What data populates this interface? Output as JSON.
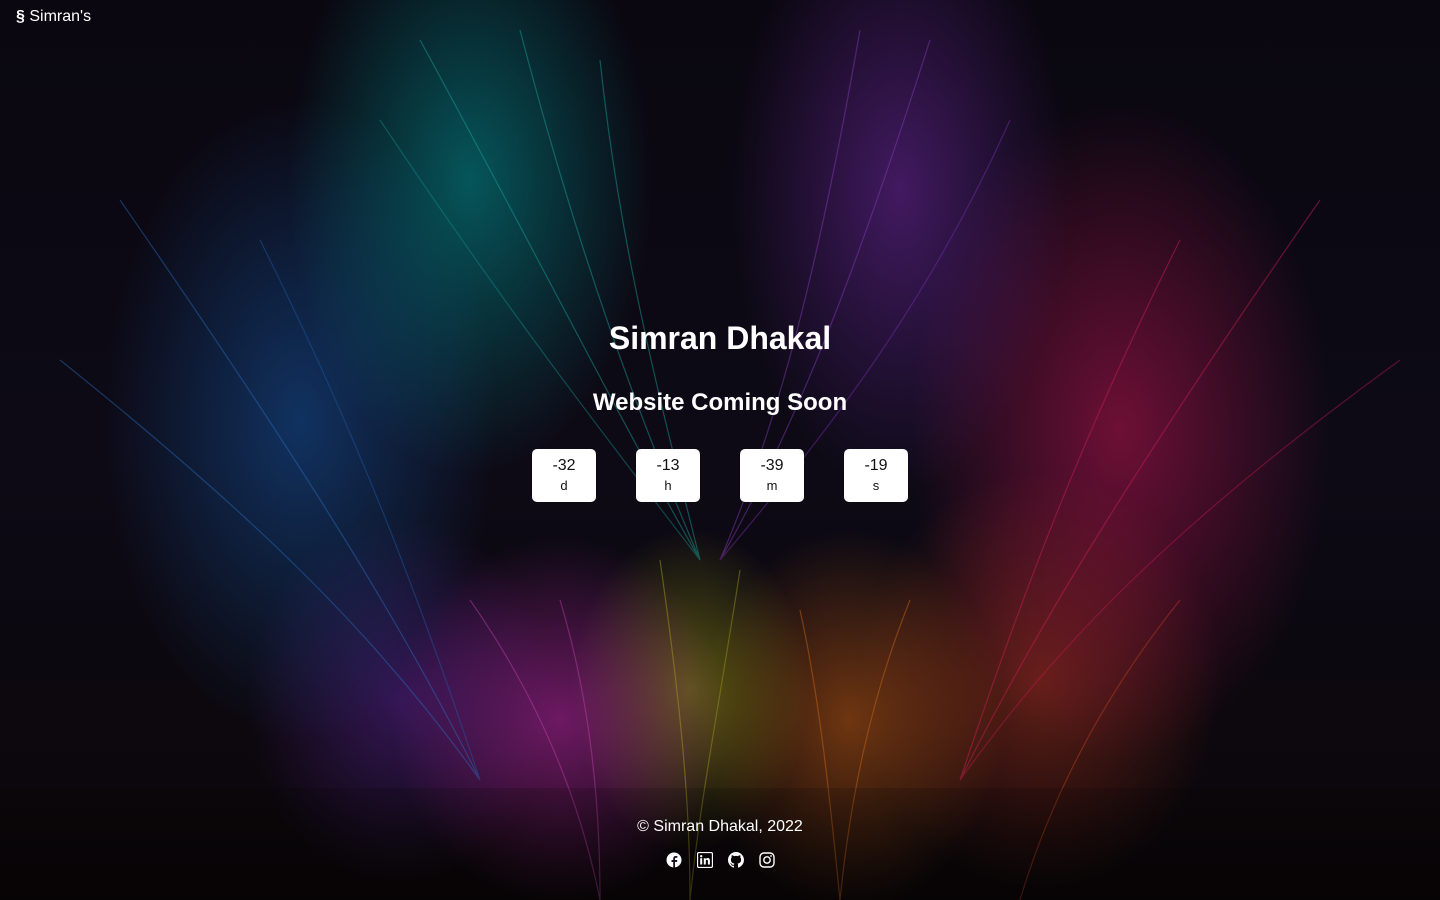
{
  "brand": {
    "symbol": "§",
    "name": "Simran's"
  },
  "hero": {
    "title": "Simran Dhakal",
    "subtitle": "Website Coming Soon"
  },
  "countdown": [
    {
      "value": "-32",
      "unit": "d"
    },
    {
      "value": "-13",
      "unit": "h"
    },
    {
      "value": "-39",
      "unit": "m"
    },
    {
      "value": "-19",
      "unit": "s"
    }
  ],
  "footer": {
    "copyright": "© Simran Dhakal, 2022",
    "social_icons": [
      "facebook-icon",
      "linkedin-icon",
      "github-icon",
      "instagram-icon"
    ]
  },
  "colors": {
    "text": "#ffffff",
    "countdown_box": "#ffffff",
    "countdown_text": "#111111"
  }
}
